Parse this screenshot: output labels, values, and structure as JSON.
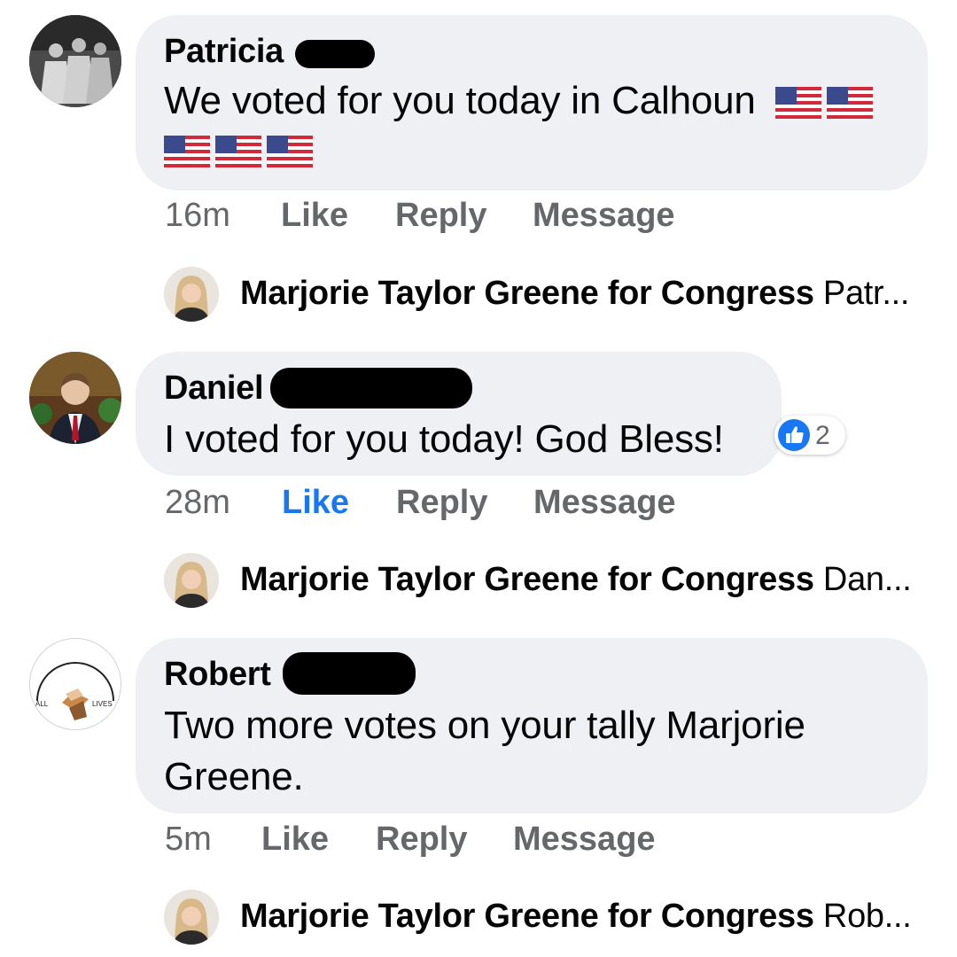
{
  "comments": [
    {
      "author": "Patricia",
      "text_line1": "We voted for you today in Calhoun",
      "emoji": "us-flag-icon",
      "emoji_count": 5,
      "time": "16m",
      "like": "Like",
      "reply": "Reply",
      "message": "Message",
      "liked": false,
      "reply_preview": {
        "name": "Marjorie Taylor Greene for Congress",
        "snippet": "Patr..."
      }
    },
    {
      "author": "Daniel",
      "text_line1": "I voted for you today! God Bless!",
      "reaction_count": "2",
      "reaction_icon": "thumbs-up-icon",
      "time": "28m",
      "like": "Like",
      "reply": "Reply",
      "message": "Message",
      "liked": true,
      "reply_preview": {
        "name": "Marjorie Taylor Greene for Congress",
        "snippet": "Dan..."
      }
    },
    {
      "author": "Robert",
      "text_line1": "Two more votes on your tally Marjorie",
      "text_line2": "Greene.",
      "avatar_text_left": "ALL",
      "avatar_text_right": "LIVES",
      "time": "5m",
      "like": "Like",
      "reply": "Reply",
      "message": "Message",
      "liked": false,
      "reply_preview": {
        "name": "Marjorie Taylor Greene for Congress",
        "snippet": "Rob..."
      }
    }
  ],
  "colors": {
    "bubble": "#eef0f3",
    "action_gray": "#65676b",
    "like_blue": "#1877f2"
  }
}
